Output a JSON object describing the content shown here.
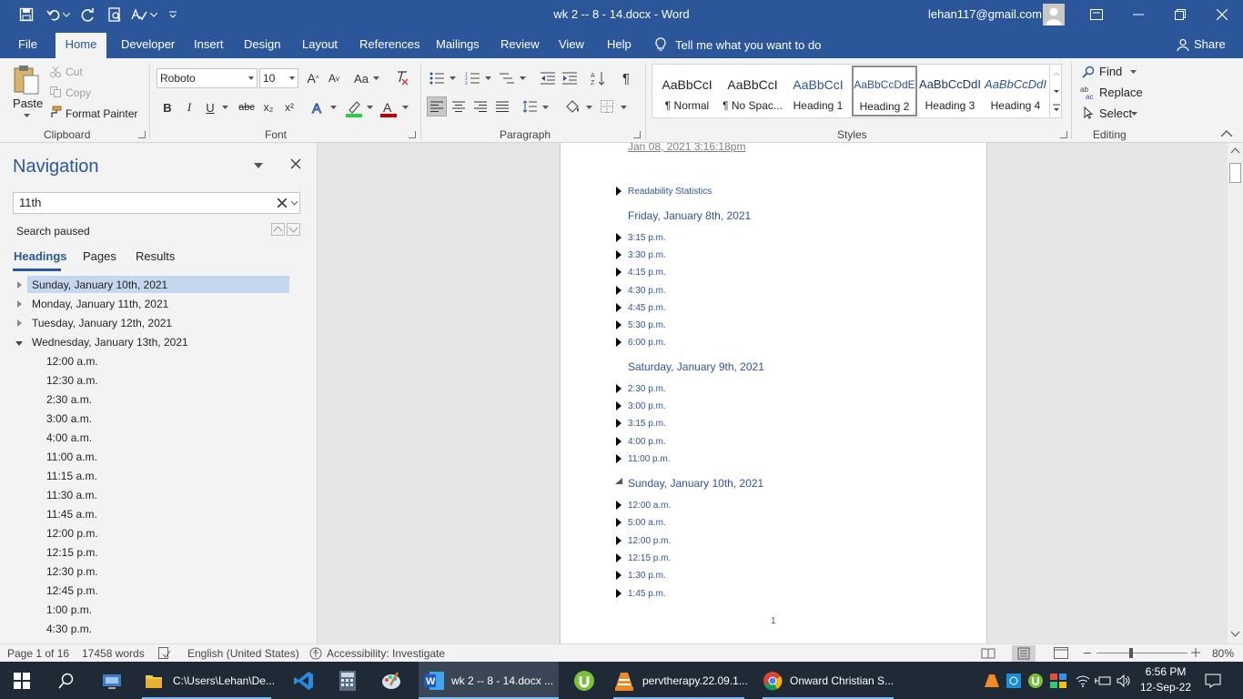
{
  "titlebar": {
    "doc_title": "wk 2 -- 8 - 14.docx  -  Word",
    "account": "lehan117@gmail.com",
    "qa_icons": [
      "save-icon",
      "undo-icon",
      "redo-icon",
      "print-preview-icon",
      "spelling-icon",
      "customize-icon"
    ]
  },
  "tabs": {
    "file": "File",
    "home": "Home",
    "developer": "Developer",
    "insert": "Insert",
    "design": "Design",
    "layout": "Layout",
    "references": "References",
    "mailings": "Mailings",
    "review": "Review",
    "view": "View",
    "help": "Help",
    "tell_me": "Tell me what you want to do",
    "share": "Share"
  },
  "ribbon": {
    "clipboard": {
      "paste": "Paste",
      "cut": "Cut",
      "copy": "Copy",
      "format_painter": "Format Painter",
      "label": "Clipboard"
    },
    "font": {
      "name": "Roboto",
      "size": "10",
      "label": "Font",
      "bold": "B",
      "italic": "I",
      "underline": "U",
      "strike": "abc",
      "sub": "x₂",
      "sup": "x²",
      "case": "Aa",
      "grow": "A",
      "shrink": "A"
    },
    "paragraph": {
      "label": "Paragraph"
    },
    "styles": {
      "label": "Styles",
      "items": [
        {
          "preview": "AaBbCcI",
          "name": "¶ Normal"
        },
        {
          "preview": "AaBbCcI",
          "name": "¶ No Spac..."
        },
        {
          "preview": "AaBbCcI",
          "name": "Heading 1"
        },
        {
          "preview": "AaBbCcDdE",
          "name": "Heading 2"
        },
        {
          "preview": "AaBbCcDdI",
          "name": "Heading 3"
        },
        {
          "preview": "AaBbCcDdI",
          "name": "Heading 4"
        }
      ]
    },
    "editing": {
      "label": "Editing",
      "find": "Find",
      "replace": "Replace",
      "select": "Select"
    }
  },
  "nav": {
    "title": "Navigation",
    "search_value": "11th",
    "status": "Search paused",
    "tab_headings": "Headings",
    "tab_pages": "Pages",
    "tab_results": "Results",
    "top_items": [
      "Sunday, January 10th, 2021",
      "Monday, January 11th, 2021",
      "Tuesday, January 12th, 2021",
      "Wednesday, January 13th, 2021"
    ],
    "sub_items": [
      "12:00 a.m.",
      "12:30 a.m.",
      "2:30 a.m.",
      "3:00 a.m.",
      "4:00 a.m.",
      "11:00 a.m.",
      "11:15 a.m.",
      "11:30 a.m.",
      "11:45 a.m.",
      "12:00 p.m.",
      "12:15 p.m.",
      "12:30 p.m.",
      "12:45 p.m.",
      "1:00 p.m.",
      "4:30 p.m."
    ]
  },
  "document": {
    "date_line": "Jan 08, 2021 3:16:18pm",
    "readability": "Readability Statistics",
    "friday": "Friday, January 8th, 2021",
    "friday_times": [
      "3:15 p.m.",
      "3:30 p.m.",
      "4:15 p.m.",
      "4:30 p.m.",
      "4:45 p.m.",
      "5:30 p.m.",
      "6:00 p.m."
    ],
    "saturday": "Saturday, January 9th, 2021",
    "saturday_times": [
      "2:30 p.m.",
      "3:00 p.m.",
      "3:15 p.m.",
      "4:00 p.m.",
      "11:00 p.m."
    ],
    "sunday": "Sunday, January 10th, 2021",
    "sunday_times": [
      "12:00 a.m.",
      "5:00 a.m.",
      "12:00 p.m.",
      "12:15 p.m.",
      "1:30 p.m.",
      "1:45 p.m."
    ],
    "page_number": "1"
  },
  "status": {
    "page": "Page 1 of 16",
    "words": "17458 words",
    "language": "English (United States)",
    "accessibility": "Accessibility: Investigate",
    "zoom": "80%"
  },
  "taskbar": {
    "explorer": "C:\\Users\\Lehan\\De...",
    "word": "wk 2 -- 8 - 14.docx ...",
    "vlc": "pervtherapy.22.09.1...",
    "chrome": "Onward Christian S...",
    "time": "6:56 PM",
    "date": "12-Sep-22"
  },
  "colors": {
    "word_blue": "#2b579a",
    "heading_blue": "#2f5496",
    "taskbar": "#1f2a36",
    "nav_selection": "#c5d7ef"
  }
}
